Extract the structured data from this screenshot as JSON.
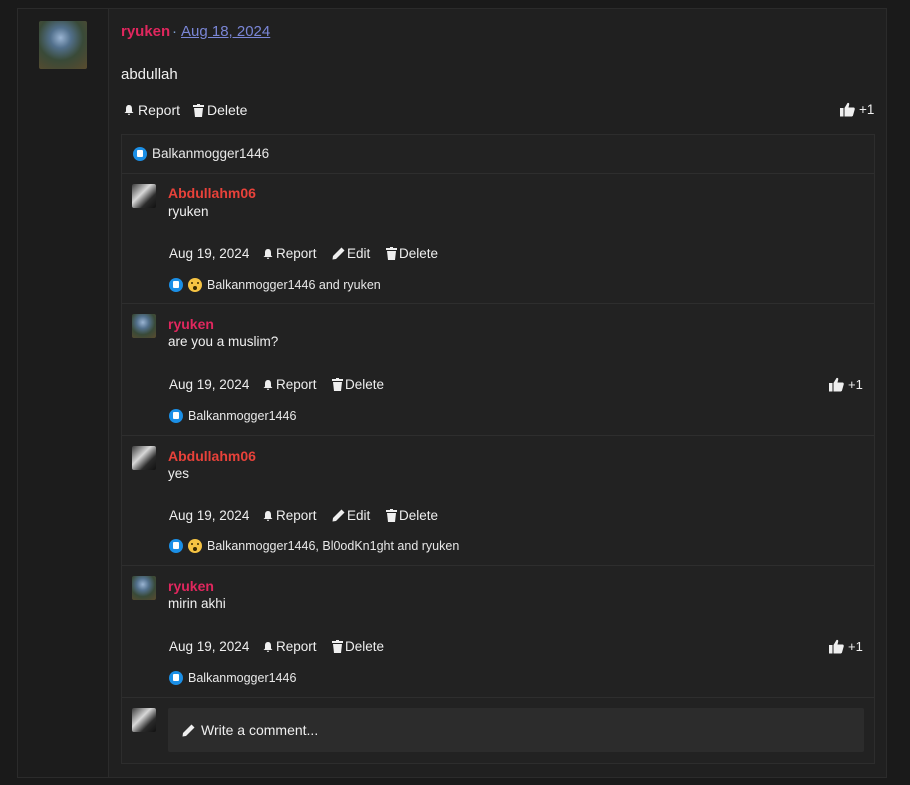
{
  "post": {
    "author": "ryuken",
    "separator": "·",
    "date": "Aug 18, 2024",
    "body": "abdullah",
    "actions": {
      "report": "Report",
      "delete": "Delete"
    },
    "like_count": "+1",
    "reactions_text": "Balkanmogger1446"
  },
  "comments": [
    {
      "author": "Abdullahm06",
      "body": "ryuken",
      "date": "Aug 19, 2024",
      "report": "Report",
      "edit": "Edit",
      "delete": "Delete",
      "reactions_text": "Balkanmogger1446 and ryuken"
    },
    {
      "author": "ryuken",
      "body": "are you a muslim?",
      "date": "Aug 19, 2024",
      "report": "Report",
      "delete": "Delete",
      "like_count": "+1",
      "reactions_text": "Balkanmogger1446"
    },
    {
      "author": "Abdullahm06",
      "body": "yes",
      "date": "Aug 19, 2024",
      "report": "Report",
      "edit": "Edit",
      "delete": "Delete",
      "reactions_text": "Balkanmogger1446, Bl0odKn1ght and ryuken"
    },
    {
      "author": "ryuken",
      "body": "mirin akhi",
      "date": "Aug 19, 2024",
      "report": "Report",
      "delete": "Delete",
      "like_count": "+1",
      "reactions_text": "Balkanmogger1446"
    }
  ],
  "composer": {
    "placeholder": "Write a comment..."
  },
  "colors": {
    "background": "#1a1a1a",
    "author_pink": "#e0275e",
    "author_red": "#e8423a",
    "link": "#7a86d6",
    "like_blue": "#1b8fe6"
  },
  "icons": [
    "bell-icon",
    "trash-icon",
    "pencil-icon",
    "thumbs-up-icon",
    "like-reaction-icon",
    "wow-reaction-icon"
  ]
}
